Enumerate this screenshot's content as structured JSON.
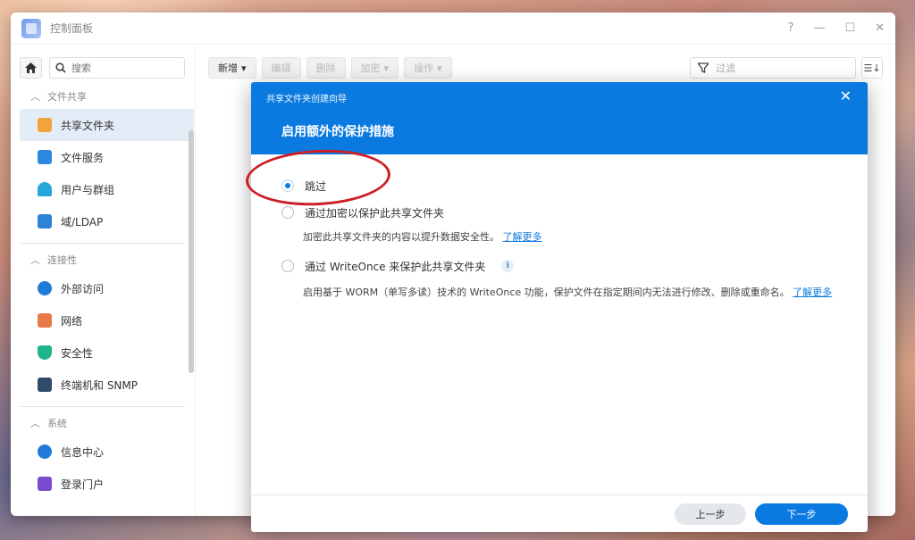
{
  "window": {
    "title": "控制面板",
    "controls": [
      "?",
      "—",
      "☐",
      "✕"
    ]
  },
  "sidebar": {
    "search_placeholder": "搜索",
    "sections": [
      {
        "header": "文件共享",
        "items": [
          {
            "label": "共享文件夹",
            "icon": "shared-folder-icon",
            "active": true
          },
          {
            "label": "文件服务",
            "icon": "file-services-icon"
          },
          {
            "label": "用户与群组",
            "icon": "user-group-icon"
          },
          {
            "label": "域/LDAP",
            "icon": "domain-ldap-icon"
          }
        ]
      },
      {
        "header": "连接性",
        "items": [
          {
            "label": "外部访问",
            "icon": "external-access-icon"
          },
          {
            "label": "网络",
            "icon": "network-icon"
          },
          {
            "label": "安全性",
            "icon": "security-icon"
          },
          {
            "label": "终端机和 SNMP",
            "icon": "terminal-icon"
          }
        ]
      },
      {
        "header": "系统",
        "items": [
          {
            "label": "信息中心",
            "icon": "info-center-icon"
          },
          {
            "label": "登录门户",
            "icon": "login-portal-icon"
          }
        ]
      }
    ]
  },
  "toolbar": {
    "new_label": "新增",
    "edit_label": "编辑",
    "delete_label": "删除",
    "encrypt_label": "加密",
    "action_label": "操作",
    "filter_placeholder": "过滤"
  },
  "dialog": {
    "subtitle": "共享文件夹创建向导",
    "title": "启用额外的保护措施",
    "options": [
      {
        "label": "跳过",
        "checked": true
      },
      {
        "label": "通过加密以保护此共享文件夹",
        "checked": false,
        "desc": "加密此共享文件夹的内容以提升数据安全性。",
        "link": "了解更多"
      },
      {
        "label": "通过 WriteOnce 来保护此共享文件夹",
        "checked": false,
        "desc": "启用基于 WORM（单写多读）技术的 WriteOnce 功能，保护文件在指定期间内无法进行修改、删除或重命名。",
        "link": "了解更多"
      }
    ],
    "prev_label": "上一步",
    "next_label": "下一步"
  },
  "colors": {
    "accent": "#0a7ae0",
    "annotation": "#cc1f26",
    "active_bg": "#e3ecf7"
  }
}
